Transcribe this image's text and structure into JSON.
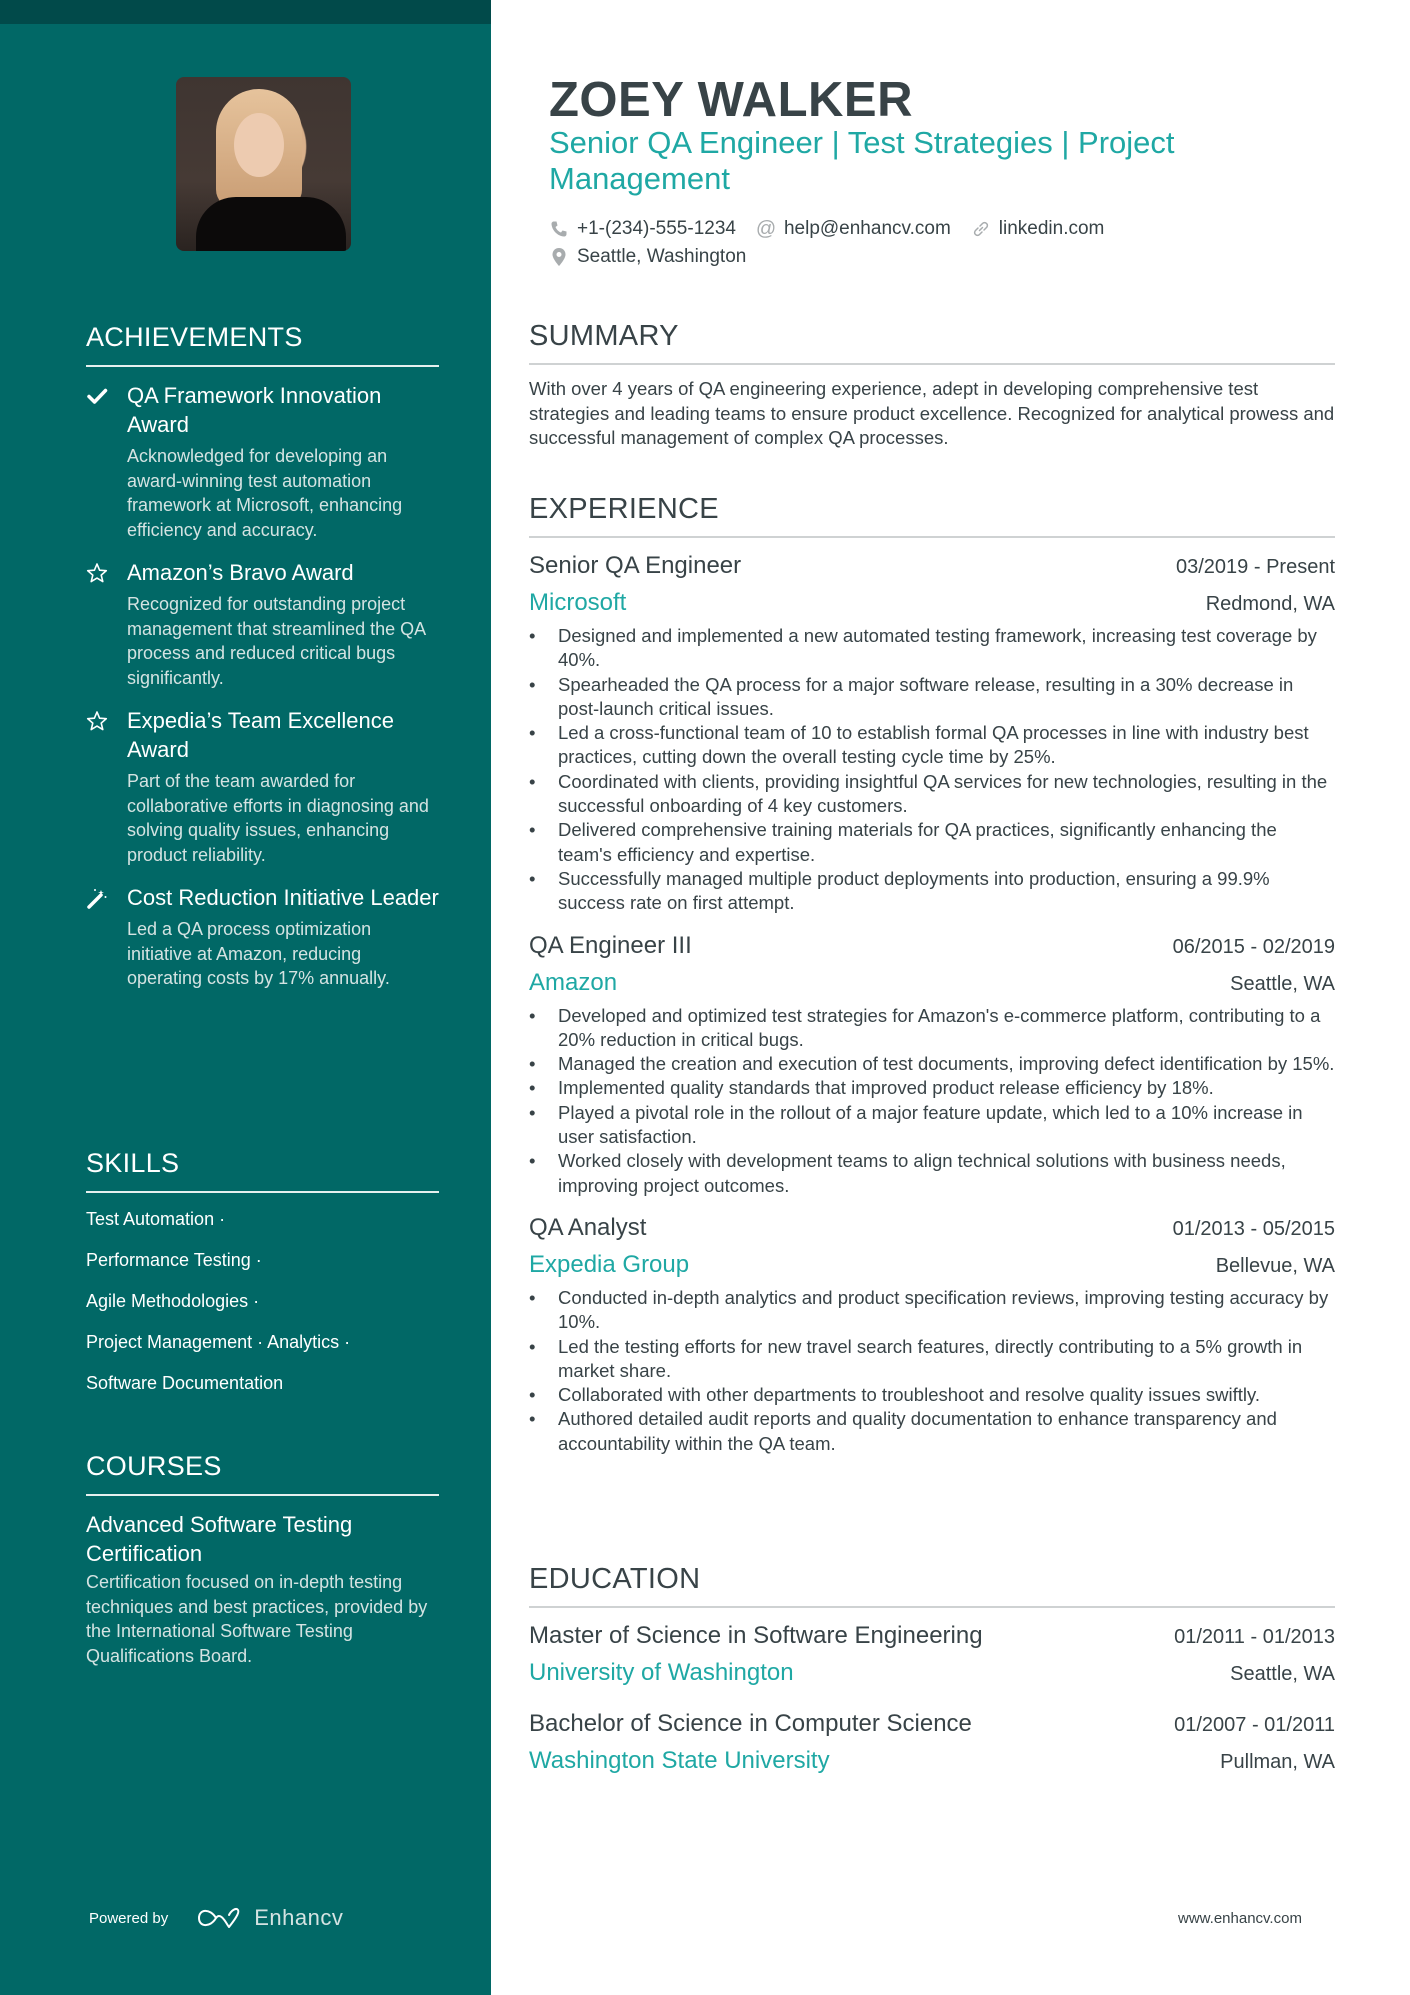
{
  "header": {
    "name": "ZOEY WALKER",
    "headline": "Senior QA Engineer | Test Strategies | Project Management",
    "contacts": [
      {
        "icon": "phone-icon",
        "text": "+1-(234)-555-1234"
      },
      {
        "icon": "at-icon",
        "text": "help@enhancv.com"
      },
      {
        "icon": "link-icon",
        "text": "linkedin.com"
      },
      {
        "icon": "location-pin-icon",
        "text": "Seattle, Washington"
      }
    ]
  },
  "colors": {
    "sidebar": "#016866",
    "sidebar_strip": "#014a4a",
    "accent": "#1fa8a4",
    "text": "#384347"
  },
  "sidebar": {
    "achievements": {
      "title": "ACHIEVEMENTS",
      "items": [
        {
          "icon": "checkmark-icon",
          "title": "QA Framework Innovation Award",
          "description": "Acknowledged for developing an award-winning test automation framework at Microsoft, enhancing efficiency and accuracy."
        },
        {
          "icon": "star-icon",
          "title": "Amazon’s Bravo Award",
          "description": "Recognized for outstanding project management that streamlined the QA process and reduced critical bugs significantly."
        },
        {
          "icon": "star-icon",
          "title": "Expedia’s Team Excellence Award",
          "description": "Part of the team awarded for collaborative efforts in diagnosing and solving quality issues, enhancing product reliability."
        },
        {
          "icon": "magic-wand-icon",
          "title": "Cost Reduction Initiative Leader",
          "description": "Led a QA process optimization initiative at Amazon, reducing operating costs by 17% annually."
        }
      ]
    },
    "skills": {
      "title": "SKILLS",
      "lines": [
        "Test Automation ·",
        "Performance Testing ·",
        "Agile Methodologies ·",
        "Project Management · Analytics ·",
        "Software Documentation"
      ]
    },
    "courses": {
      "title": "COURSES",
      "items": [
        {
          "title": "Advanced Software Testing Certification",
          "description": "Certification focused on in-depth testing techniques and best practices, provided by the International Software Testing Qualifications Board."
        }
      ]
    },
    "powered_by": {
      "label": "Powered by",
      "brand": "Enhancv"
    }
  },
  "main": {
    "summary": {
      "title": "SUMMARY",
      "text": "With over 4 years of QA engineering experience, adept in developing comprehensive test strategies and leading teams to ensure product excellence. Recognized for analytical prowess and successful management of complex QA processes."
    },
    "experience": {
      "title": "EXPERIENCE",
      "jobs": [
        {
          "title": "Senior QA Engineer",
          "dates": "03/2019 - Present",
          "company": "Microsoft",
          "location": "Redmond, WA",
          "bullets": [
            "Designed and implemented a new automated testing framework, increasing test coverage by 40%.",
            "Spearheaded the QA process for a major software release, resulting in a 30% decrease in post-launch critical issues.",
            "Led a cross-functional team of 10 to establish formal QA processes in line with industry best practices, cutting down the overall testing cycle time by 25%.",
            "Coordinated with clients, providing insightful QA services for new technologies, resulting in the successful onboarding of 4 key customers.",
            "Delivered comprehensive training materials for QA practices, significantly enhancing the team's efficiency and expertise.",
            "Successfully managed multiple product deployments into production, ensuring a 99.9% success rate on first attempt."
          ]
        },
        {
          "title": "QA Engineer III",
          "dates": "06/2015 - 02/2019",
          "company": "Amazon",
          "location": "Seattle, WA",
          "bullets": [
            "Developed and optimized test strategies for Amazon's e-commerce platform, contributing to a 20% reduction in critical bugs.",
            "Managed the creation and execution of test documents, improving defect identification by 15%.",
            "Implemented quality standards that improved product release efficiency by 18%.",
            "Played a pivotal role in the rollout of a major feature update, which led to a 10% increase in user satisfaction.",
            "Worked closely with development teams to align technical solutions with business needs, improving project outcomes."
          ]
        },
        {
          "title": "QA Analyst",
          "dates": "01/2013 - 05/2015",
          "company": "Expedia Group",
          "location": "Bellevue, WA",
          "bullets": [
            "Conducted in-depth analytics and product specification reviews, improving testing accuracy by 10%.",
            "Led the testing efforts for new travel search features, directly contributing to a 5% growth in market share.",
            "Collaborated with other departments to troubleshoot and resolve quality issues swiftly.",
            "Authored detailed audit reports and quality documentation to enhance transparency and accountability within the QA team."
          ]
        }
      ]
    },
    "education": {
      "title": "EDUCATION",
      "items": [
        {
          "degree": "Master of Science in Software Engineering",
          "dates": "01/2011 - 01/2013",
          "school": "University of Washington",
          "location": "Seattle, WA"
        },
        {
          "degree": "Bachelor of Science in Computer Science",
          "dates": "01/2007 - 01/2011",
          "school": "Washington State University",
          "location": "Pullman, WA"
        }
      ]
    }
  },
  "footer": {
    "url": "www.enhancv.com"
  }
}
